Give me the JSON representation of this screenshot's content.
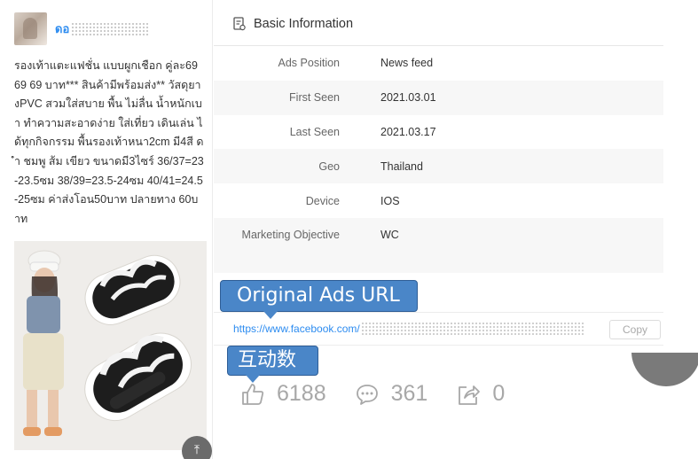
{
  "advertiser": {
    "name": "ดอ"
  },
  "post": {
    "caption": "รองเท้าแตะแฟชั่น แบบผูกเชือก คู่ละ69 69 69 บาท*** สินค้ามีพร้อมส่ง** วัสดุยางPVC สวมใส่สบาย พื้น ไม่ลื่น น้ำหนักเบา ทำความสะอาดง่าย ใส่เที่ยว เดินเล่น ได้ทุกกิจกรรม พื้นรองเท้าหนา2cm มี4สี ดำ ชมพู ส้ม เขียว ขนาดมี3ไซร์ 36/37=23-23.5ซม 38/39=23.5-24ซม 40/41=24.5-25ซม ค่าส่งโอน50บาท ปลายทาง 60บาท"
  },
  "basic_info": {
    "title": "Basic Information",
    "rows": [
      {
        "key": "Ads Position",
        "value": "News feed"
      },
      {
        "key": "First Seen",
        "value": "2021.03.01"
      },
      {
        "key": "Last Seen",
        "value": "2021.03.17"
      },
      {
        "key": "Geo",
        "value": "Thailand"
      },
      {
        "key": "Device",
        "value": "IOS"
      },
      {
        "key": "Marketing Objective",
        "value": "WC"
      }
    ]
  },
  "annotations": {
    "url_label": "Original Ads URL",
    "interaction_label": "互动数"
  },
  "ad_url": {
    "link_text": "https://www.facebook.com/",
    "copy_label": "Copy"
  },
  "stats": {
    "likes": "6188",
    "comments": "361",
    "shares": "0"
  },
  "colors": {
    "link": "#2d8cf0",
    "callout": "#4a86c8",
    "stat_grey": "#a8a8a8"
  },
  "icons": [
    "document-icon",
    "thumbs-up-icon",
    "comment-icon",
    "share-icon",
    "back-to-top-icon"
  ]
}
